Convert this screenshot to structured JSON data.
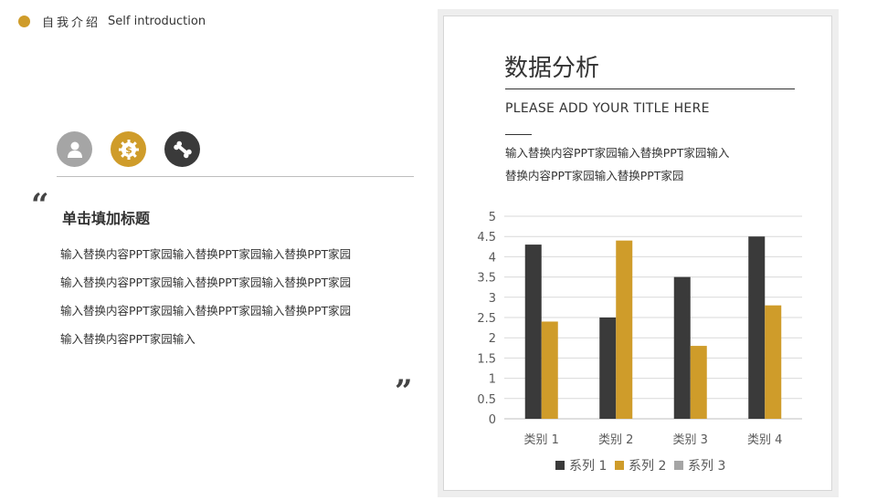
{
  "header": {
    "title_cn": "自我介绍",
    "title_en": "Self introduction"
  },
  "left": {
    "icons": [
      "user-icon",
      "dollar-gear-icon",
      "bone-icon"
    ],
    "title": "单击填加标题",
    "body": [
      "输入替换内容PPT家园输入替换PPT家园输入替换PPT家园",
      "输入替换内容PPT家园输入替换PPT家园输入替换PPT家园",
      "输入替换内容PPT家园输入替换PPT家园输入替换PPT家园",
      "输入替换内容PPT家园输入"
    ]
  },
  "card": {
    "title": "数据分析",
    "subtitle": "PLEASE ADD YOUR TITLE HERE",
    "desc": [
      "输入替换内容PPT家园输入替换PPT家园输入",
      "替换内容PPT家园输入替换PPT家园"
    ]
  },
  "colors": {
    "accent": "#cf9c2a",
    "dark": "#3a3a3a",
    "gray": "#a5a5a5"
  },
  "chart_data": {
    "type": "bar",
    "title": "",
    "categories": [
      "类别 1",
      "类别 2",
      "类别 3",
      "类别 4"
    ],
    "series": [
      {
        "name": "系列 1",
        "color": "#3a3a3a",
        "values": [
          4.3,
          2.5,
          3.5,
          4.5
        ]
      },
      {
        "name": "系列 2",
        "color": "#cf9c2a",
        "values": [
          2.4,
          4.4,
          1.8,
          2.8
        ]
      },
      {
        "name": "系列 3",
        "color": "#a5a5a5",
        "values": []
      }
    ],
    "ylim": [
      0,
      5
    ],
    "yticks": [
      "0",
      "0.5",
      "1",
      "1.5",
      "2",
      "2.5",
      "3",
      "3.5",
      "4",
      "4.5",
      "5"
    ],
    "grid": true,
    "legend": "bottom"
  }
}
